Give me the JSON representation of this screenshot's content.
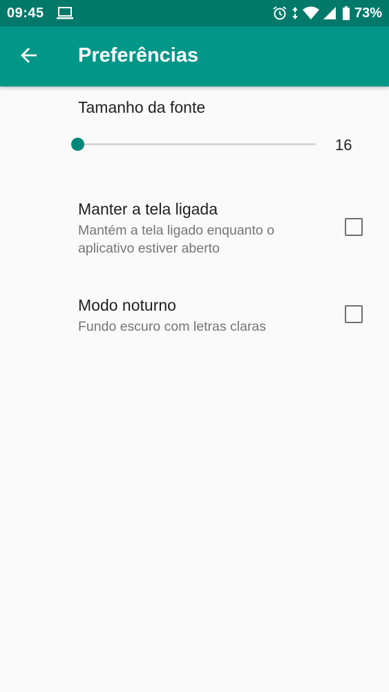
{
  "status_bar": {
    "time": "09:45",
    "battery_percent": "73%",
    "icons": [
      "laptop-icon",
      "alarm-icon",
      "data-arrows-icon",
      "wifi-icon",
      "signal-icon",
      "battery-icon"
    ]
  },
  "app_bar": {
    "title": "Preferências",
    "back_icon": "arrow-left-icon"
  },
  "preferences": {
    "font_size": {
      "title": "Tamanho da fonte",
      "value": "16",
      "slider_fraction": 0.0
    },
    "keep_screen_on": {
      "title": "Manter a tela ligada",
      "summary": "Mantém a tela ligado enquanto o aplicativo estiver aberto",
      "checked": false
    },
    "night_mode": {
      "title": "Modo noturno",
      "summary": "Fundo escuro com letras claras",
      "checked": false
    }
  },
  "colors": {
    "status_bar": "#00796b",
    "app_bar": "#009688",
    "accent": "#00897b",
    "background": "#fafafa",
    "primary_text": "#212121",
    "secondary_text": "#757575"
  }
}
